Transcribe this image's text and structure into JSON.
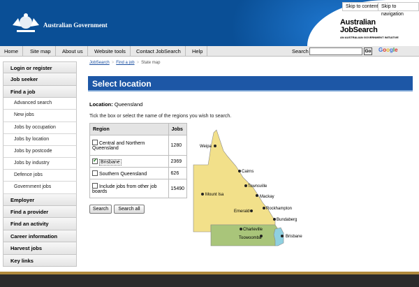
{
  "header": {
    "gov_name": "Australian Government",
    "skip_content": "Skip to content",
    "skip_navigation": "Skip to navigation",
    "brand_line1": "Australian",
    "brand_line2": "JobSearch",
    "brand_line3": "AN AUSTRALIAN GOVERNMENT INITIATIVE"
  },
  "nav": {
    "items": [
      "Home",
      "Site map",
      "About us",
      "Website tools",
      "Contact JobSearch",
      "Help"
    ],
    "search_label": "Search",
    "search_value": "",
    "go_label": "Go",
    "google_label": "Google"
  },
  "sidebar": {
    "items": [
      {
        "label": "Login or register",
        "type": "main"
      },
      {
        "label": "Job seeker",
        "type": "main"
      },
      {
        "label": "Find a job",
        "type": "main"
      },
      {
        "label": "Advanced search",
        "type": "sub"
      },
      {
        "label": "New jobs",
        "type": "sub"
      },
      {
        "label": "Jobs by occupation",
        "type": "sub"
      },
      {
        "label": "Jobs by location",
        "type": "sub"
      },
      {
        "label": "Jobs by postcode",
        "type": "sub"
      },
      {
        "label": "Jobs by industry",
        "type": "sub"
      },
      {
        "label": "Defence jobs",
        "type": "sub"
      },
      {
        "label": "Government jobs",
        "type": "sub"
      },
      {
        "label": "Employer",
        "type": "main"
      },
      {
        "label": "Find a provider",
        "type": "main"
      },
      {
        "label": "Find an activity",
        "type": "main"
      },
      {
        "label": "Career information",
        "type": "main"
      },
      {
        "label": "Harvest jobs",
        "type": "main"
      },
      {
        "label": "Key links",
        "type": "main"
      }
    ]
  },
  "breadcrumb": {
    "items": [
      "JobSearch",
      "Find a job",
      "State map"
    ],
    "separator": ">"
  },
  "main": {
    "title": "Select location",
    "location_label": "Location:",
    "location_value": "Queensland",
    "instructions": "Tick the box or select the name of the regions you wish to search.",
    "table_headers": [
      "Region",
      "Jobs"
    ],
    "regions": [
      {
        "label": "Central and Northern Queensland",
        "jobs": "1280",
        "checked": false
      },
      {
        "label": "Brisbane",
        "jobs": "2369",
        "checked": true
      },
      {
        "label": "Southern Queensland",
        "jobs": "626",
        "checked": false
      },
      {
        "label": "Include jobs from other job boards",
        "jobs": "15490",
        "checked": false
      }
    ],
    "search_button": "Search",
    "search_all_button": "Search all"
  },
  "map": {
    "places": [
      "Weipa",
      "Cairns",
      "Townsville",
      "Mount Isa",
      "Mackay",
      "Emerald",
      "Rockhampton",
      "Bundaberg",
      "Charleville",
      "Toowoomba",
      "Brisbane"
    ],
    "colors": {
      "north": "#f2e08a",
      "south": "#a9c57a",
      "brisbane": "#8fd0e0"
    }
  },
  "colors": {
    "header": "#0a4f96",
    "title_bar": "#1d57a6",
    "footer": "#2b2b2b",
    "footer_stripe": "#b08a3c"
  }
}
